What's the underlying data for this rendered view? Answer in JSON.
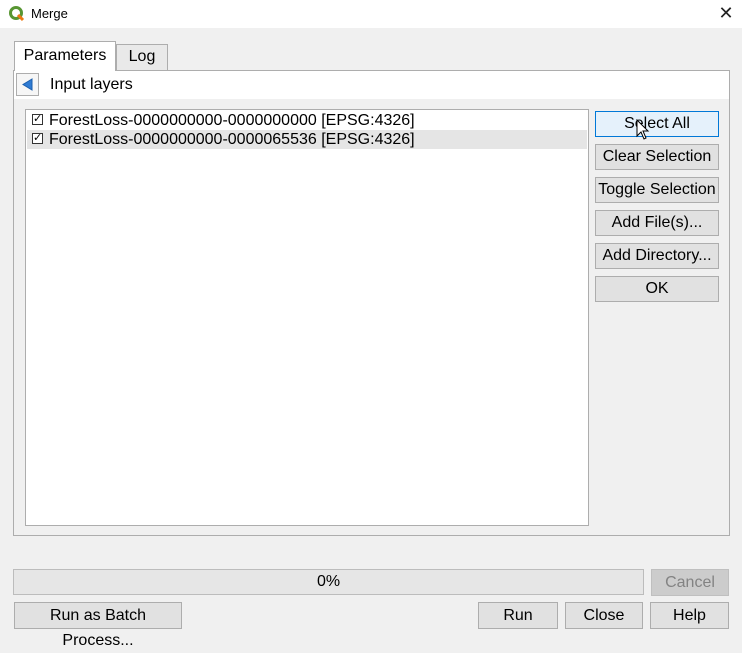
{
  "window": {
    "title": "Merge",
    "app_icon": "qgis-logo-icon",
    "close_glyph": "✕"
  },
  "tabs": [
    {
      "label": "Parameters",
      "active": true
    },
    {
      "label": "Log",
      "active": false
    }
  ],
  "section": {
    "back_icon": "triangle-left-icon",
    "label": "Input layers"
  },
  "layers": [
    {
      "label": "ForestLoss-0000000000-0000000000 [EPSG:4326]",
      "checked": true,
      "selected": false
    },
    {
      "label": "ForestLoss-0000000000-0000065536 [EPSG:4326]",
      "checked": true,
      "selected": true
    }
  ],
  "side_buttons": {
    "select_all": "Select All",
    "clear_selection": "Clear Selection",
    "toggle_selection": "Toggle Selection",
    "add_files": "Add File(s)...",
    "add_directory": "Add Directory...",
    "ok": "OK"
  },
  "progress": {
    "text": "0%",
    "value": 0
  },
  "footer": {
    "cancel": "Cancel",
    "batch": "Run as Batch Process...",
    "run": "Run",
    "close": "Close",
    "help": "Help"
  },
  "colors": {
    "accent": "#0078d7",
    "qgis_green": "#589632",
    "qgis_yellow": "#ee7913"
  }
}
